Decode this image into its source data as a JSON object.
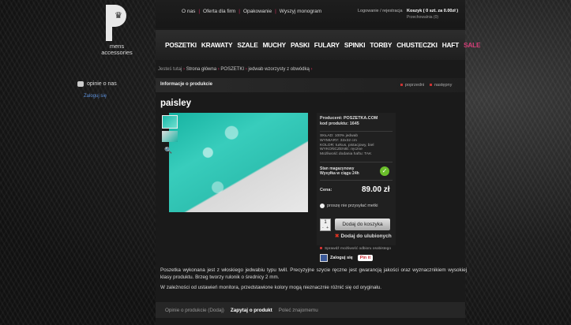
{
  "logo": {
    "text_line1": "mens",
    "text_line2": "accessories"
  },
  "sidebar": {
    "opinions_label": "opinie o nas",
    "login_label": "Zaloguj się"
  },
  "top": {
    "links": [
      "O nas",
      "Oferta dla firm",
      "Opakowanie",
      "Wyszyj monogram"
    ],
    "account_login": "Logowanie",
    "account_register": "rejestracja",
    "cart_label": "Koszyk ( 0 szt. za 0.00zł )",
    "cart_stored": "Przechowalnia (0)"
  },
  "menu": {
    "items": [
      "POSZETKI",
      "KRAWATY",
      "SZALE",
      "MUCHY",
      "PASKI",
      "FULARY",
      "SPINKI",
      "TORBY",
      "CHUSTECZKI",
      "HAFT",
      "SALE"
    ]
  },
  "breadcrumb": {
    "prefix": "Jesteś tutaj",
    "items": [
      "Strona główna",
      "POSZETKI",
      "jedwab wzorzysty z obwódką"
    ]
  },
  "infobar": {
    "label": "Informacje o produkcie",
    "prev": "poprzedni",
    "next": "następny"
  },
  "product": {
    "title": "paisley",
    "producer": "Producent: POSZETKA.COM",
    "code": "kod produktu: 1645",
    "specs": [
      "SKŁAD: 100% jedwab",
      "WYMIARY: 32x32 cm",
      "KOLOR: turkus, pistacjowy, biel",
      "WYKOŃCZENIE: ręczne",
      "Możliwość dodania haftu: TAK"
    ],
    "stock_label": "Stan magazynowy",
    "shipping": "Wysyłka w ciągu 24h",
    "price_label": "Cena:",
    "price": "89.00 zł",
    "cheaper": "proszę nie przysyłać metki",
    "qty": "1",
    "add_to_cart": "Dodaj do koszyka",
    "add_fav": "Dodaj do ulubionych",
    "check_personalize": "Sprawdź możliwość odbioru osobistego",
    "login_fb": "Zaloguj się",
    "pin": "Pin it",
    "description": "Poszetka wykonana jest z  włoskiego jedwabiu typu twill. Precyzyjne szycie ręczne jest gwarancją jakości oraz wyznacznikiem wysokiej klasy produktu. Brzeg tworzy rulonik o średnicy 2 mm.",
    "description2": "W zależności od ustawień monitora, przedstawione kolory mogą nieznacznie różnić się od oryginału."
  },
  "tabs": [
    "Opinie o produkcie (Dodaj)",
    "Zapytaj o produkt",
    "Poleć znajomemu"
  ]
}
